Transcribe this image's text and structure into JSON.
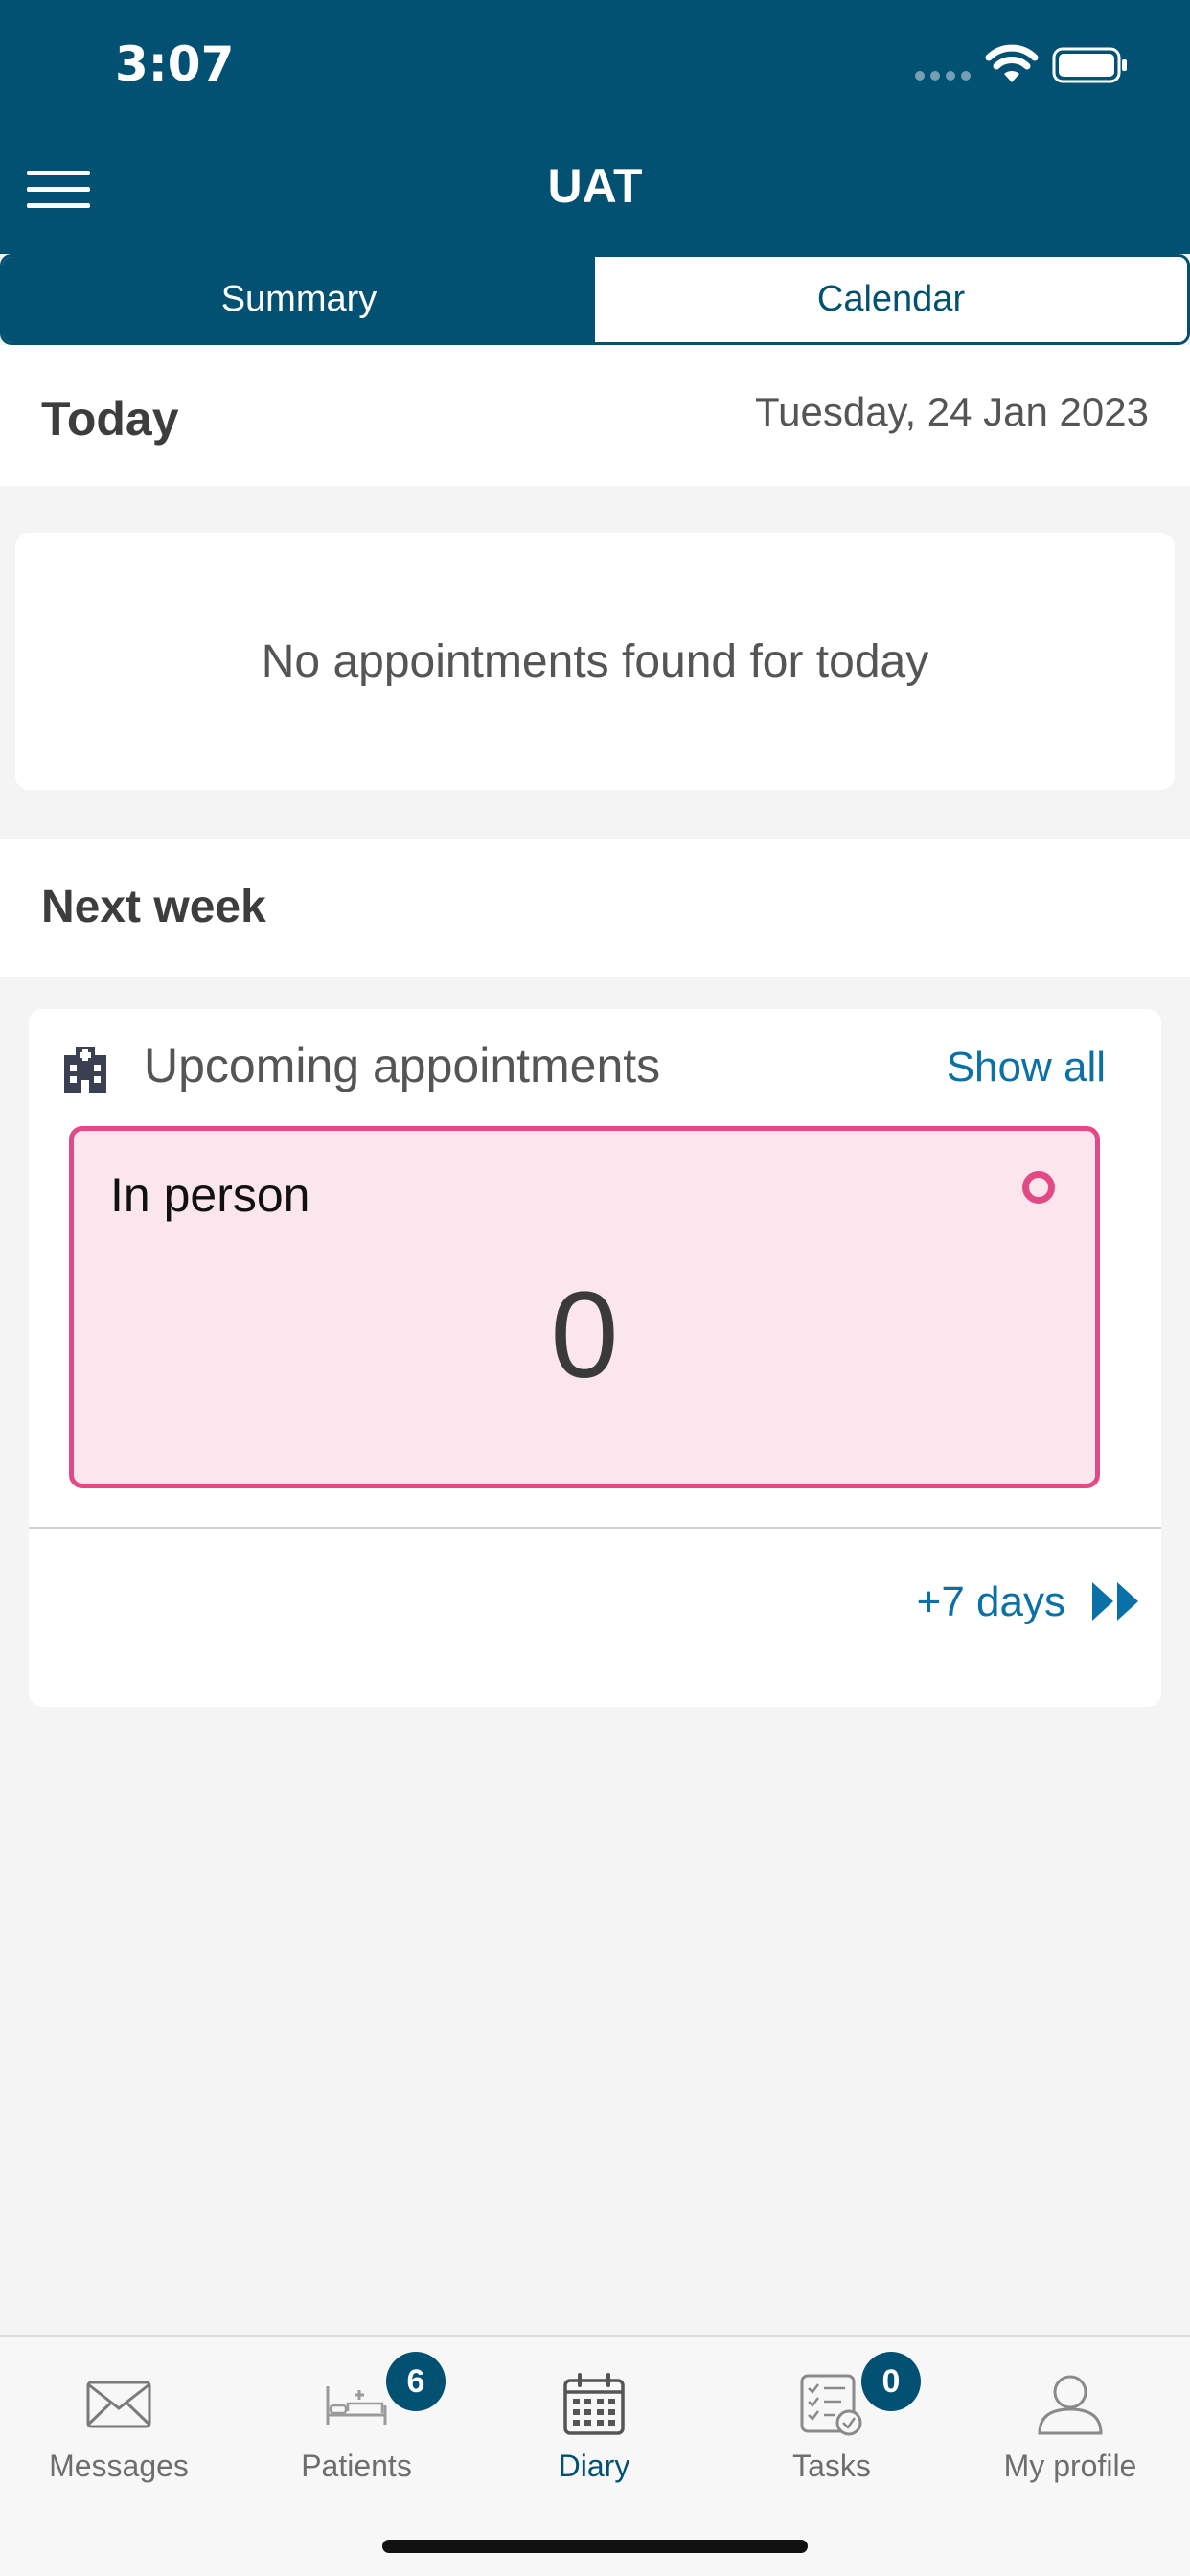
{
  "status_bar": {
    "time": "3:07"
  },
  "header": {
    "title": "UAT"
  },
  "tabs": {
    "summary": "Summary",
    "calendar": "Calendar"
  },
  "today": {
    "label": "Today",
    "date": "Tuesday, 24 Jan 2023",
    "empty_message": "No appointments found for today"
  },
  "next_week": {
    "label": "Next week",
    "card_title": "Upcoming appointments",
    "show_all": "Show all",
    "in_person_label": "In person",
    "in_person_count": "0",
    "forward_label": "+7 days"
  },
  "nav": {
    "messages": "Messages",
    "patients": "Patients",
    "patients_badge": "6",
    "diary": "Diary",
    "tasks": "Tasks",
    "tasks_badge": "0",
    "profile": "My profile"
  },
  "colors": {
    "brand": "#025172",
    "accent_link": "#0a70a8",
    "in_person_border": "#e24a85",
    "in_person_bg": "#fce6ee"
  }
}
